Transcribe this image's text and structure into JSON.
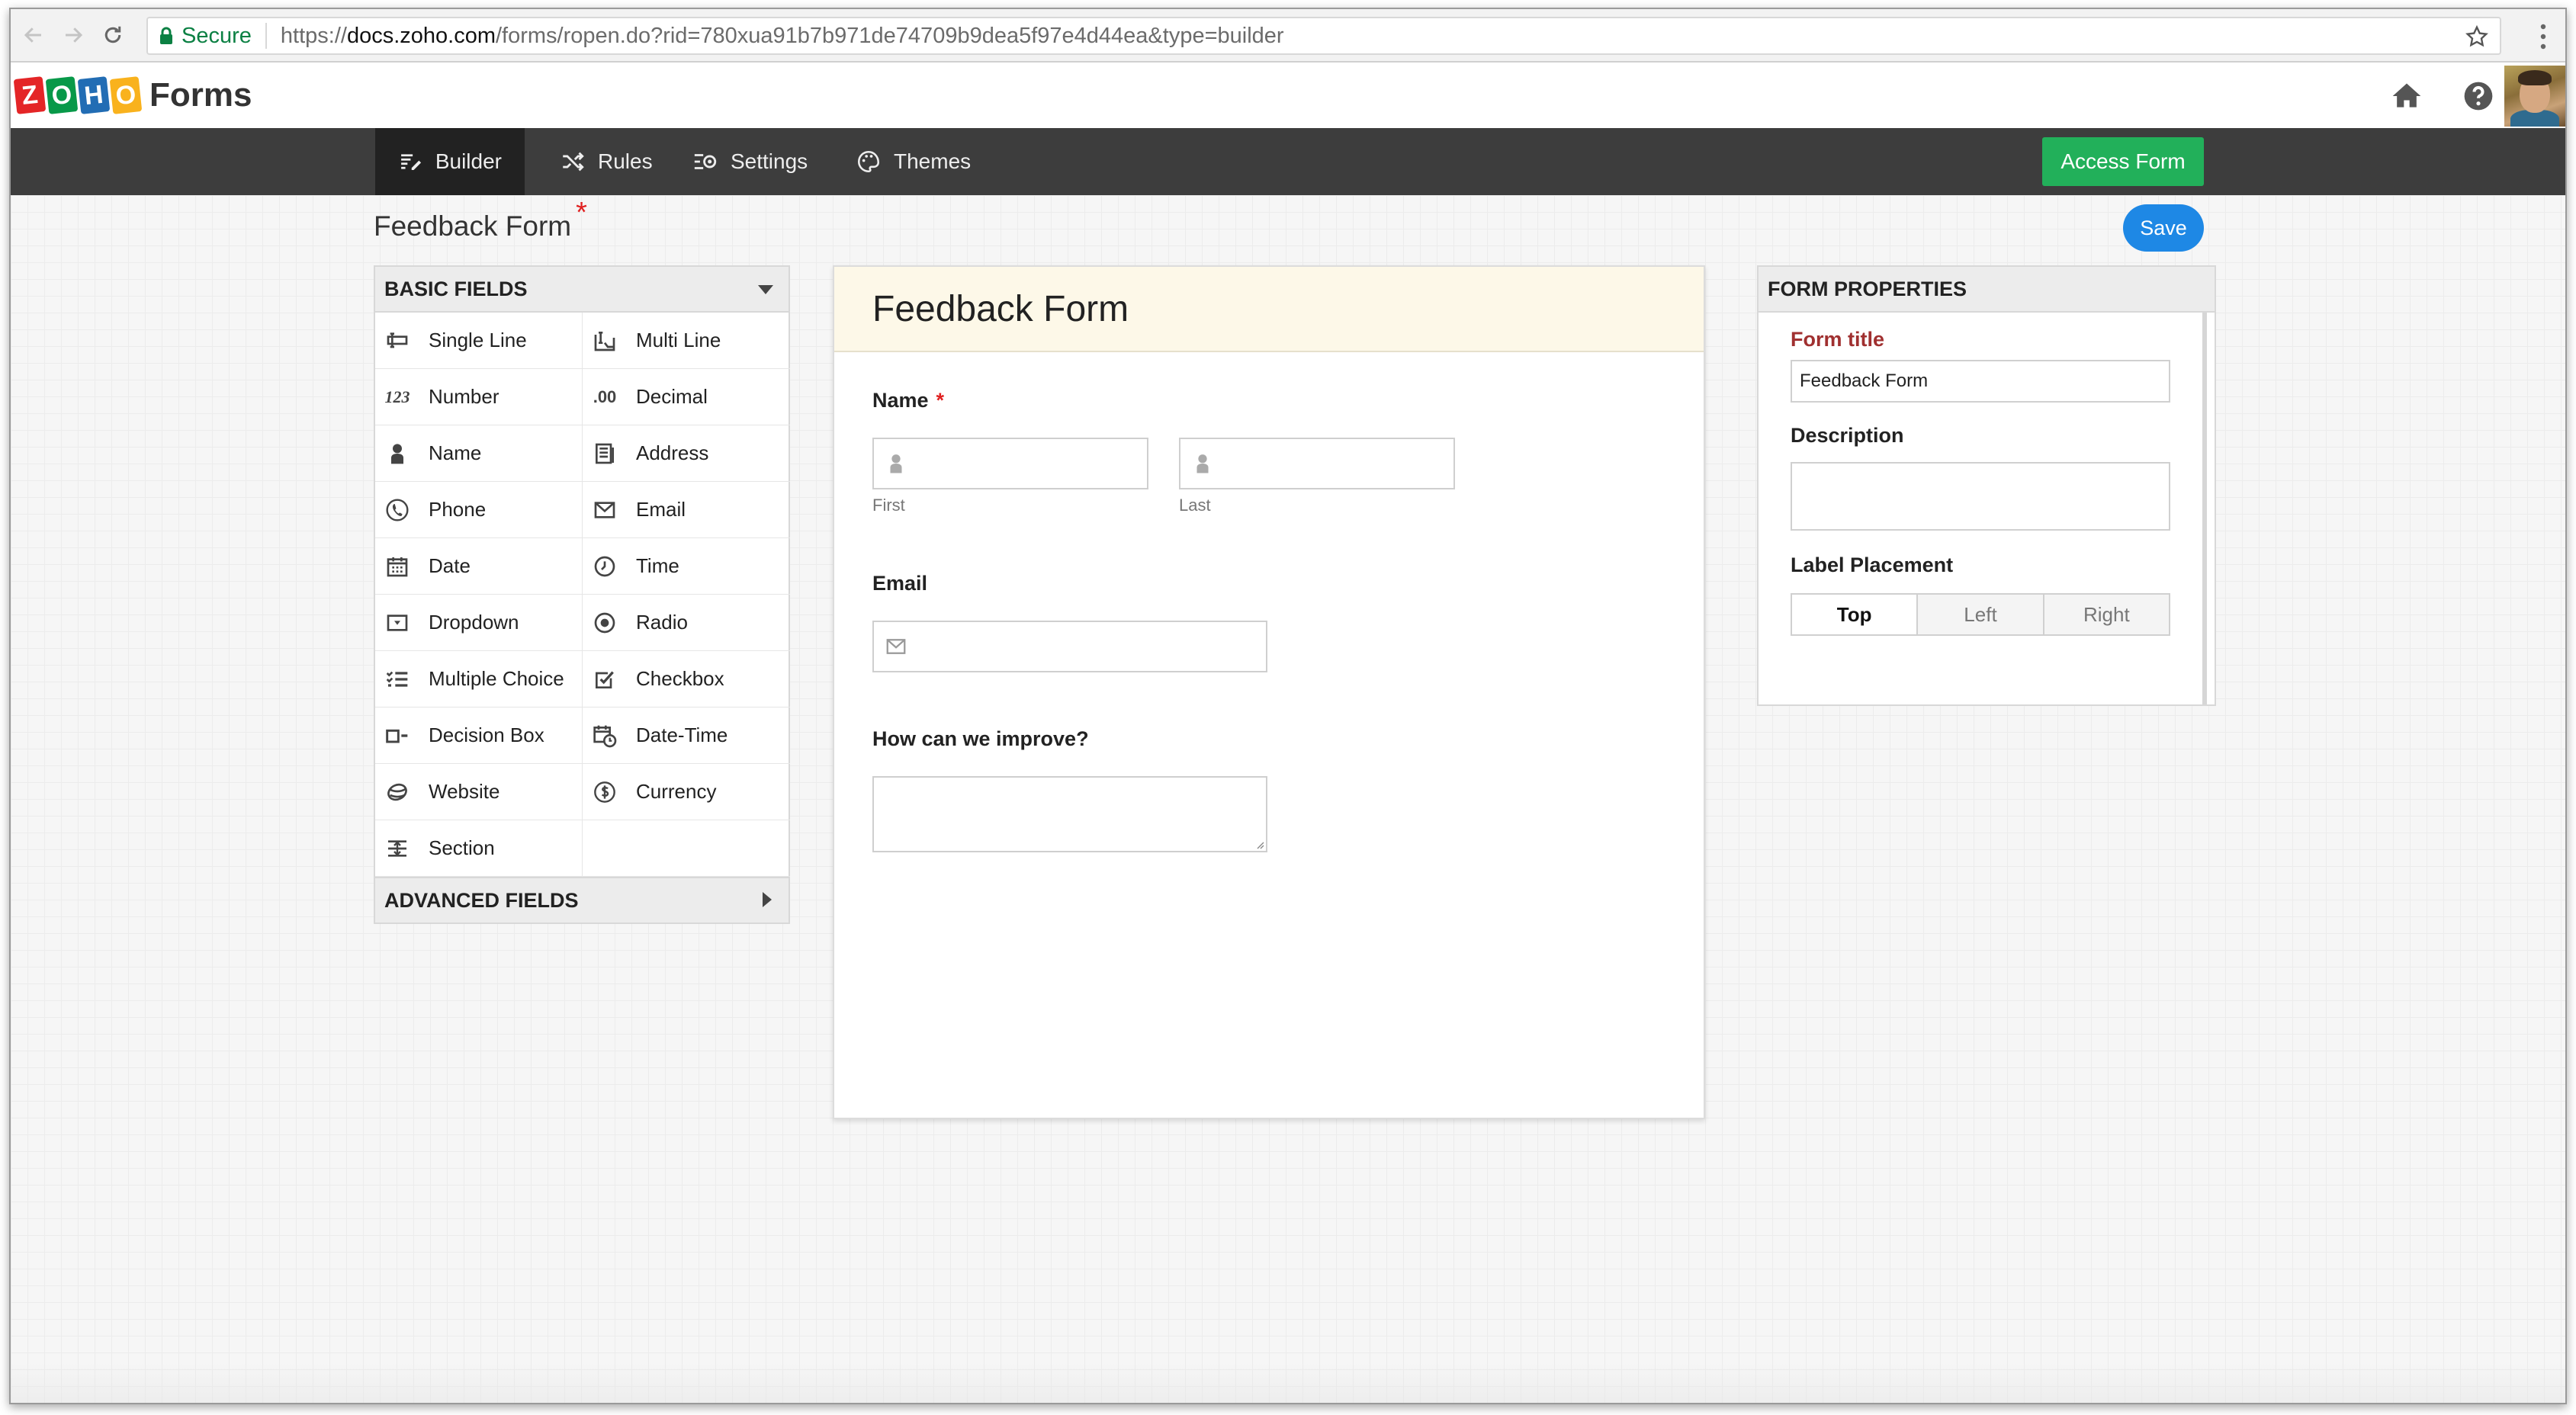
{
  "browser": {
    "secure_label": "Secure",
    "url_scheme": "https://",
    "url_host": "docs.zoho.com",
    "url_path": "/forms/ropen.do?rid=780xua91b7b971de74709b9dea5f97e4d44ea&type=builder"
  },
  "app": {
    "logo_letters": [
      "Z",
      "O",
      "H",
      "O"
    ],
    "logo_colors": [
      "#e42527",
      "#089949",
      "#226db4",
      "#f9b21d"
    ],
    "product_name": "Forms"
  },
  "toolbar": {
    "tabs": [
      {
        "label": "Builder",
        "icon": "builder-icon",
        "active": true
      },
      {
        "label": "Rules",
        "icon": "shuffle-icon",
        "active": false
      },
      {
        "label": "Settings",
        "icon": "settings-icon",
        "active": false
      },
      {
        "label": "Themes",
        "icon": "palette-icon",
        "active": false
      }
    ],
    "access_form_label": "Access Form"
  },
  "builder": {
    "form_name": "Feedback Form",
    "required_mark": "*",
    "save_label": "Save"
  },
  "fields_panel": {
    "basic_title": "BASIC FIELDS",
    "advanced_title": "ADVANCED FIELDS",
    "items": [
      {
        "label": "Single Line",
        "icon": "single-line-icon"
      },
      {
        "label": "Multi Line",
        "icon": "multi-line-icon"
      },
      {
        "label": "Number",
        "icon": "number-icon",
        "glyph": "123"
      },
      {
        "label": "Decimal",
        "icon": "decimal-icon",
        "glyph": ".00"
      },
      {
        "label": "Name",
        "icon": "person-icon"
      },
      {
        "label": "Address",
        "icon": "address-icon"
      },
      {
        "label": "Phone",
        "icon": "phone-icon"
      },
      {
        "label": "Email",
        "icon": "envelope-icon"
      },
      {
        "label": "Date",
        "icon": "calendar-icon"
      },
      {
        "label": "Time",
        "icon": "clock-icon"
      },
      {
        "label": "Dropdown",
        "icon": "dropdown-icon"
      },
      {
        "label": "Radio",
        "icon": "radio-icon"
      },
      {
        "label": "Multiple Choice",
        "icon": "multiple-choice-icon"
      },
      {
        "label": "Checkbox",
        "icon": "checkbox-icon"
      },
      {
        "label": "Decision Box",
        "icon": "decision-box-icon"
      },
      {
        "label": "Date-Time",
        "icon": "date-time-icon"
      },
      {
        "label": "Website",
        "icon": "globe-icon"
      },
      {
        "label": "Currency",
        "icon": "currency-icon"
      },
      {
        "label": "Section",
        "icon": "section-icon"
      }
    ]
  },
  "form_preview": {
    "title": "Feedback Form",
    "name_label": "Name",
    "name_required": "*",
    "first_label": "First",
    "last_label": "Last",
    "email_label": "Email",
    "improve_label": "How can we improve?"
  },
  "properties": {
    "title": "FORM PROPERTIES",
    "form_title_label": "Form title",
    "form_title_value": "Feedback Form",
    "description_label": "Description",
    "label_placement_label": "Label Placement",
    "placement_options": [
      "Top",
      "Left",
      "Right"
    ],
    "placement_selected": "Top"
  }
}
